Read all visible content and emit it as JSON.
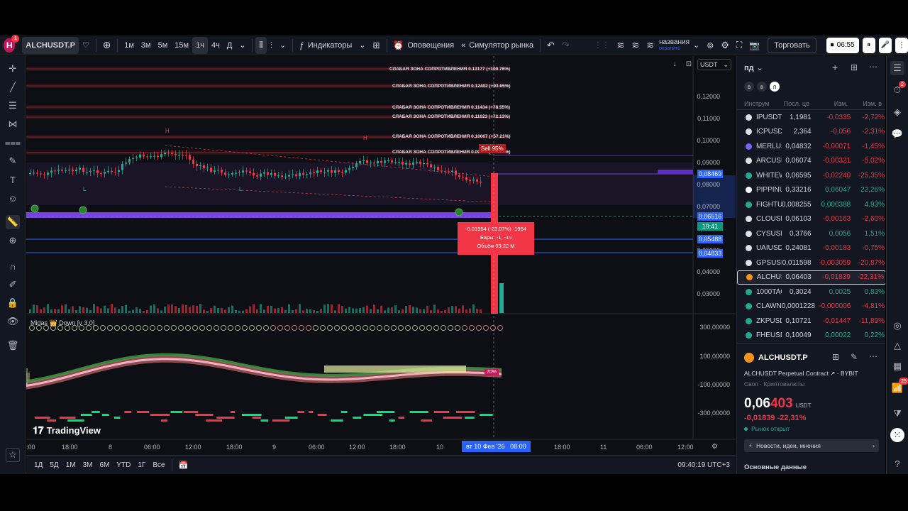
{
  "topbar": {
    "logo": "H",
    "logo_badge": "1",
    "symbol": "ALCHUSDT.P",
    "intervals": [
      "1м",
      "3м",
      "5м",
      "15м",
      "1ч",
      "4ч",
      "Д"
    ],
    "active_interval": "1ч",
    "indicators_label": "Индикаторы",
    "alerts_label": "Оповещения",
    "replay_label": "Симулятор рынка",
    "layout_title": "названия",
    "layout_subtitle": "охранить",
    "trade_label": "Торговать",
    "timer": "06:55"
  },
  "chart": {
    "currency": "USDT",
    "price_axis": [
      "0,12000",
      "0,11000",
      "0,10000",
      "0,09000",
      "0,08000",
      "0,07000",
      "0,06000",
      "0,05000",
      "0,04000",
      "0,03000"
    ],
    "price_tags": [
      {
        "value": "0,08469",
        "color": "#2962ff"
      },
      {
        "value": "0,06516",
        "color": "#2962ff"
      },
      {
        "value": "19:41",
        "color": "#089981"
      },
      {
        "value": "0,05488",
        "color": "#2962ff"
      },
      {
        "value": "0,04833",
        "color": "#2962ff"
      }
    ],
    "zones": [
      "СЛАБАЯ ЗОНА СОПРОТИВЛЕНИЯ 0.13177 (+109.76%)",
      "СЛАБАЯ ЗОНА СОПРОТИВЛЕНИЯ 0.12402 (+93.65%)",
      "СЛАБАЯ ЗОНА СОПРОТИВЛЕНИЯ 0.11434 (+78.55%)",
      "СЛАБАЯ ЗОНА СОПРОТИВЛЕНИЯ 0.11023 (+72.13%)",
      "СЛАБАЯ ЗОНА СОПРОТИВЛЕНИЯ 0.10067 (+57.21%)",
      "СЛАБАЯ ЗОНА СОПРОТИВЛЕНИЯ 0.09386 (+46.57%)"
    ],
    "sell_label": "Sell 95%",
    "measure": {
      "line1": "-0,01954 (-23,07%) -1954",
      "line2": "Бары: -1, -1ч",
      "line3": "Объём 99,22 М"
    },
    "indicator_name": "Midas 👑 Down [v 3.0]",
    "indicator_axis": [
      "300,00000",
      "100,00000",
      "-100,00000",
      "-300,00000"
    ],
    "indicator_badge": "70%",
    "time_axis": [
      ":00",
      "18:00",
      "8",
      "06:00",
      "12:00",
      "18:00",
      "9",
      "06:00",
      "12:00",
      "18:00",
      "10",
      "18:00",
      "11",
      "06:00",
      "12:00"
    ],
    "time_highlight": "вт 10 Фев '26   08:00",
    "watermark": "TradingView"
  },
  "bottombar": {
    "ranges": [
      "1Д",
      "5Д",
      "1М",
      "3М",
      "6М",
      "YTD",
      "1Г",
      "Все"
    ],
    "clock": "09:40:19 UTC+3"
  },
  "watchlist": {
    "title": "пд",
    "tabs": [
      "в",
      "в",
      "п"
    ],
    "headers": [
      "Инструм",
      "Посл. це",
      "Изм.",
      "Изм. в"
    ],
    "rows": [
      {
        "sym": "IPUSDT",
        "last": "1,1981",
        "chg": "-0,0335",
        "pct": "-2,72%",
        "color": "#e0e0e0",
        "neg": true
      },
      {
        "sym": "ICPUSDT",
        "last": "2,364",
        "chg": "-0,056",
        "pct": "-2,31%",
        "color": "#e0e0e0",
        "neg": true
      },
      {
        "sym": "MERLUS",
        "last": "0,04832",
        "chg": "-0,00071",
        "pct": "-1,45%",
        "color": "#7b61ff",
        "neg": true
      },
      {
        "sym": "ARCUSD",
        "last": "0,06074",
        "chg": "-0,00321",
        "pct": "-5,02%",
        "color": "#e0e0e0",
        "neg": true
      },
      {
        "sym": "WHITEW",
        "last": "0,06595",
        "chg": "-0,02240",
        "pct": "-25,35%",
        "color": "#22ab94",
        "neg": true
      },
      {
        "sym": "PIPPINU",
        "last": "0,33216",
        "chg": "0,06047",
        "pct": "22,26%",
        "color": "#ffffff",
        "neg": false
      },
      {
        "sym": "FIGHTU",
        "last": "0,008255",
        "chg": "0,000388",
        "pct": "4,93%",
        "color": "#22ab94",
        "neg": false
      },
      {
        "sym": "CLOUSD",
        "last": "0,06103",
        "chg": "-0,00163",
        "pct": "-2,60%",
        "color": "#e0e0e0",
        "neg": true
      },
      {
        "sym": "CYSUSD",
        "last": "0,3766",
        "chg": "0,0056",
        "pct": "1,51%",
        "color": "#e0e0e0",
        "neg": false
      },
      {
        "sym": "UAIUSDT",
        "last": "0,24081",
        "chg": "-0,00183",
        "pct": "-0,75%",
        "color": "#e0e0e0",
        "neg": true
      },
      {
        "sym": "GPSUSD",
        "last": "0,011598",
        "chg": "-0,003059",
        "pct": "-20,87%",
        "color": "#e0e0e0",
        "neg": true
      },
      {
        "sym": "ALCHUS",
        "last": "0,06403",
        "chg": "-0,01839",
        "pct": "-22,31%",
        "color": "#f7931a",
        "neg": true
      },
      {
        "sym": "1000TAG",
        "last": "0,3024",
        "chg": "0,0025",
        "pct": "0,83%",
        "color": "#22ab94",
        "neg": false
      },
      {
        "sym": "CLAWNC",
        "last": "0,0001228",
        "chg": "-0,000006",
        "pct": "-4,81%",
        "color": "#22ab94",
        "neg": true
      },
      {
        "sym": "ZKPUSD",
        "last": "0,10721",
        "chg": "-0,01447",
        "pct": "-11,89%",
        "color": "#22ab94",
        "neg": true
      },
      {
        "sym": "FHEUSD",
        "last": "0,10049",
        "chg": "0,00022",
        "pct": "0,22%",
        "color": "#22ab94",
        "neg": false
      }
    ],
    "selected_index": 11
  },
  "details": {
    "symbol": "ALCHUSDT.P",
    "name": "ALCHUSDT Perpetual Contract",
    "exchange": "BYBIT",
    "type": "Своп · Криптовалюты",
    "price_main": "0,06",
    "price_tail": "403",
    "currency": "USDT",
    "change": "-0,01839 -22,31%",
    "status": "Рынок открыт",
    "news_label": "Новости, идеи, мнения",
    "section": "Основные данные"
  },
  "rightbar": {
    "badge1": "2",
    "badge2": "25"
  }
}
